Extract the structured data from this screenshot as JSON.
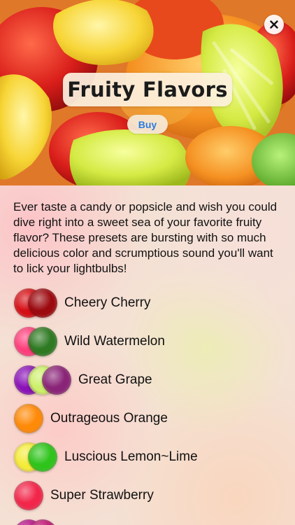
{
  "header": {
    "close_icon": "close-icon",
    "title": "Fruity Flavors",
    "buy_label": "Buy"
  },
  "description": "Ever taste a candy or popsicle and wish you could dive right into a sweet sea of your favorite fruity flavor? These presets are bursting with so much delicious color and scrumptious sound you'll want to lick your lightbulbs!",
  "flavors": [
    {
      "name": "Cheery Cherry",
      "colors": [
        "#d50f15",
        "#9c0a10"
      ]
    },
    {
      "name": "Wild Watermelon",
      "colors": [
        "#ff3f7c",
        "#2e7a22"
      ]
    },
    {
      "name": "Great Grape",
      "colors": [
        "#8a12b8",
        "#cdf06a",
        "#8a2478"
      ]
    },
    {
      "name": "Outrageous Orange",
      "colors": [
        "#ff8a08"
      ]
    },
    {
      "name": "Luscious Lemon~Lime",
      "colors": [
        "#f5ec3a",
        "#2ec41c"
      ]
    },
    {
      "name": "Super Strawberry",
      "colors": [
        "#f2264a"
      ]
    },
    {
      "name": "",
      "colors": [
        "#b8148a",
        "#c01874"
      ]
    }
  ]
}
